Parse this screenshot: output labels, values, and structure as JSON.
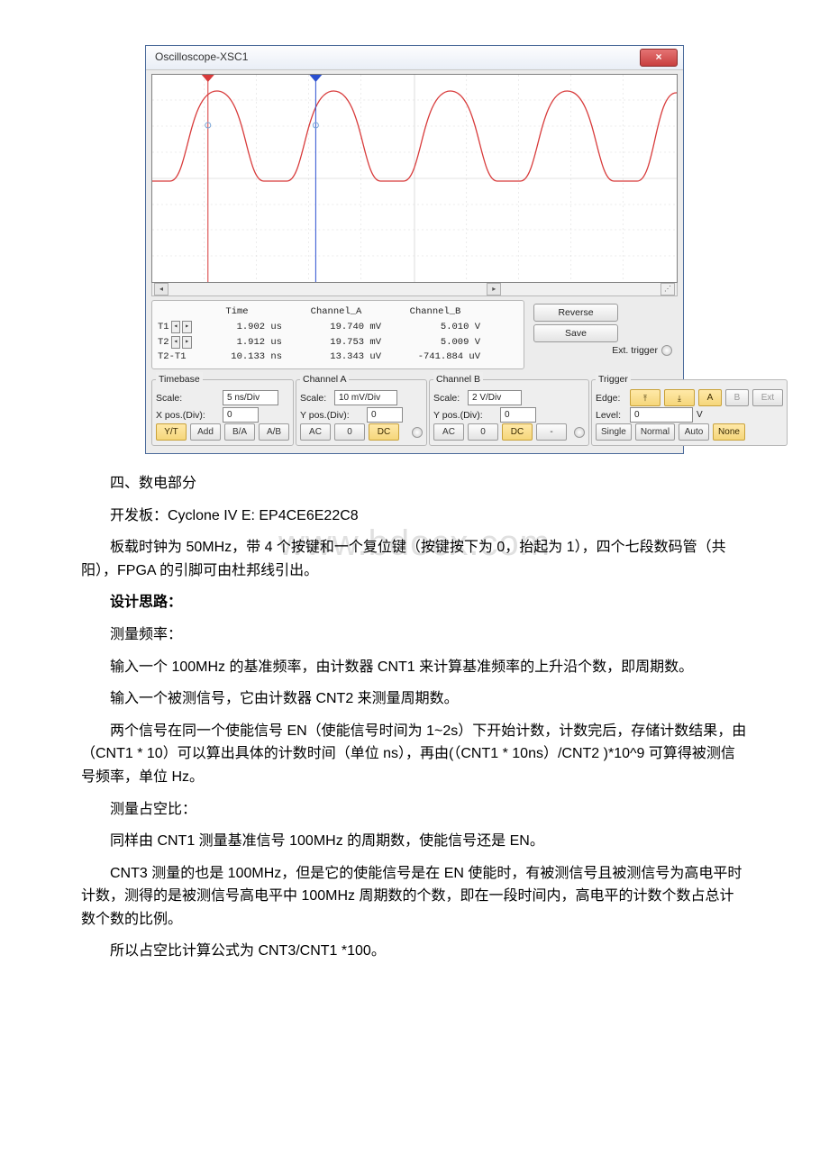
{
  "osc": {
    "title": "Oscilloscope-XSC1",
    "closeLabel": "×",
    "cursor": {
      "headers": {
        "time": "Time",
        "cha": "Channel_A",
        "chb": "Channel_B"
      },
      "t1": {
        "label": "T1",
        "time": "1.902 us",
        "cha": "19.740 mV",
        "chb": "5.010 V"
      },
      "t2": {
        "label": "T2",
        "time": "1.912 us",
        "cha": "19.753 mV",
        "chb": "5.009 V"
      },
      "dt": {
        "label": "T2-T1",
        "time": "10.133 ns",
        "cha": "13.343 uV",
        "chb": "-741.884 uV"
      }
    },
    "buttons": {
      "reverse": "Reverse",
      "save": "Save",
      "ext": "Ext. trigger"
    },
    "timebase": {
      "legend": "Timebase",
      "scaleLbl": "Scale:",
      "scaleVal": "5 ns/Div",
      "xposLbl": "X pos.(Div):",
      "xposVal": "0",
      "yt": "Y/T",
      "add": "Add",
      "ba": "B/A",
      "ab": "A/B"
    },
    "cha": {
      "legend": "Channel A",
      "scaleLbl": "Scale:",
      "scaleVal": "10 mV/Div",
      "yposLbl": "Y pos.(Div):",
      "yposVal": "0",
      "ac": "AC",
      "zero": "0",
      "dc": "DC"
    },
    "chb": {
      "legend": "Channel B",
      "scaleLbl": "Scale:",
      "scaleVal": "2 V/Div",
      "yposLbl": "Y pos.(Div):",
      "yposVal": "0",
      "ac": "AC",
      "zero": "0",
      "dc": "DC",
      "minus": "-"
    },
    "trg": {
      "legend": "Trigger",
      "edgeLbl": "Edge:",
      "levelLbl": "Level:",
      "levelVal": "0",
      "levelUnit": "V",
      "rise": "↱",
      "fall": "↳",
      "a": "A",
      "b": "B",
      "ext": "Ext",
      "single": "Single",
      "normal": "Normal",
      "auto": "Auto",
      "none": "None"
    }
  },
  "chart_data": {
    "type": "line",
    "title": "Oscilloscope-XSC1 waveform",
    "x_unit": "ns",
    "y_axes": [
      {
        "name": "Channel_A",
        "scale_per_div": "10 mV",
        "color": "#d03030"
      },
      {
        "name": "Channel_B",
        "scale_per_div": "2 V",
        "color": "#2050d0"
      }
    ],
    "timebase_per_div": "5 ns",
    "cursors": [
      {
        "name": "T1",
        "x_us": 1.902,
        "chA_mV": 19.74,
        "chB_V": 5.01,
        "marker_color": "#d03030"
      },
      {
        "name": "T2",
        "x_us": 1.912,
        "chA_mV": 19.753,
        "chB_V": 5.009,
        "marker_color": "#2050d0"
      }
    ],
    "delta": {
      "dt_ns": 10.133,
      "dChA_uV": 13.343,
      "dChB_uV": -741.884
    },
    "waveform_shape": "periodic half-sine pulses (red trace), ~4.5 cycles visible across the display; cursors T1 (red) and T2 (blue) near start of first two rising edges"
  },
  "doc": {
    "watermark": "www.bdocx.com",
    "p1": "四、数电部分",
    "p2": "开发板：Cyclone IV E: EP4CE6E22C8",
    "p3": "板载时钟为 50MHz，带 4 个按键和一个复位键（按键按下为 0，抬起为 1），四个七段数码管（共阳），FPGA 的引脚可由杜邦线引出。",
    "p4": "设计思路：",
    "p5": "测量频率：",
    "p6": "输入一个 100MHz 的基准频率，由计数器 CNT1 来计算基准频率的上升沿个数，即周期数。",
    "p7": "输入一个被测信号，它由计数器 CNT2 来测量周期数。",
    "p8": "两个信号在同一个使能信号 EN（使能信号时间为 1~2s）下开始计数，计数完后，存储计数结果，由（CNT1 * 10）可以算出具体的计数时间（单位 ns），再由(（CNT1 * 10ns）/CNT2 )*10^9 可算得被测信号频率，单位 Hz。",
    "p9": "测量占空比：",
    "p10": "同样由 CNT1 测量基准信号 100MHz 的周期数，使能信号还是 EN。",
    "p11": "CNT3 测量的也是 100MHz，但是它的使能信号是在 EN 使能时，有被测信号且被测信号为高电平时计数，测得的是被测信号高电平中 100MHz 周期数的个数，即在一段时间内，高电平的计数个数占总计数个数的比例。",
    "p12": "所以占空比计算公式为 CNT3/CNT1 *100。"
  }
}
